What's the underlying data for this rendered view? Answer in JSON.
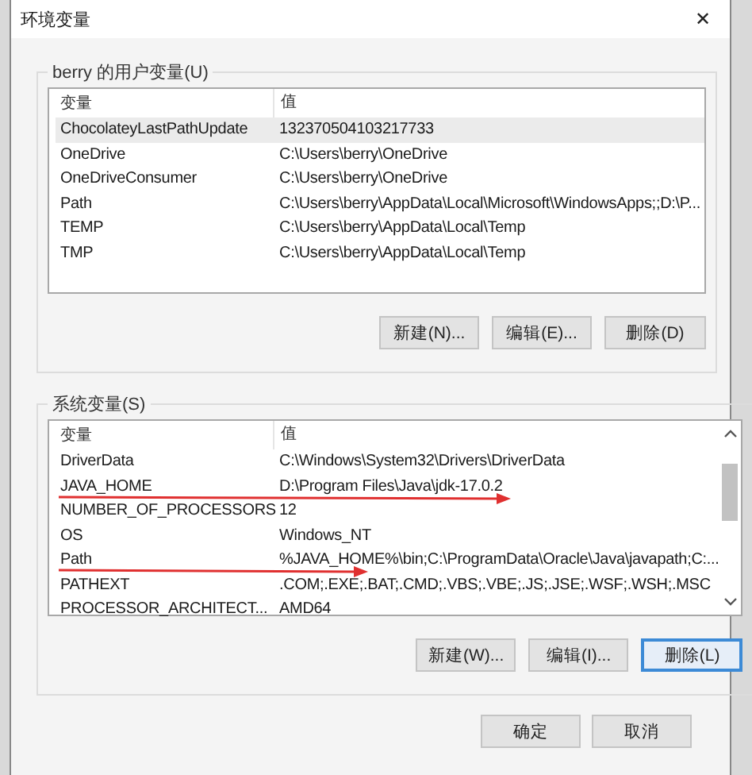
{
  "window": {
    "title": "环境变量",
    "close": "✕"
  },
  "user_group": {
    "title": "berry 的用户变量(U)",
    "columns": [
      "变量",
      "值"
    ],
    "rows": [
      {
        "name": "ChocolateyLastPathUpdate",
        "value": "132370504103217733",
        "selected": true
      },
      {
        "name": "OneDrive",
        "value": "C:\\Users\\berry\\OneDrive",
        "selected": false
      },
      {
        "name": "OneDriveConsumer",
        "value": "C:\\Users\\berry\\OneDrive",
        "selected": false
      },
      {
        "name": "Path",
        "value": "C:\\Users\\berry\\AppData\\Local\\Microsoft\\WindowsApps;;D:\\P...",
        "selected": false
      },
      {
        "name": "TEMP",
        "value": "C:\\Users\\berry\\AppData\\Local\\Temp",
        "selected": false
      },
      {
        "name": "TMP",
        "value": "C:\\Users\\berry\\AppData\\Local\\Temp",
        "selected": false
      }
    ],
    "buttons": [
      {
        "label": "新建(N)...",
        "focused": false
      },
      {
        "label": "编辑(E)...",
        "focused": false
      },
      {
        "label": "删除(D)",
        "focused": false
      }
    ]
  },
  "system_group": {
    "title": "系统变量(S)",
    "columns": [
      "变量",
      "值"
    ],
    "rows": [
      {
        "name": "DriverData",
        "value": "C:\\Windows\\System32\\Drivers\\DriverData",
        "selected": false,
        "underlined": false
      },
      {
        "name": "JAVA_HOME",
        "value": "D:\\Program Files\\Java\\jdk-17.0.2",
        "selected": false,
        "underlined": true
      },
      {
        "name": "NUMBER_OF_PROCESSORS",
        "value": "12",
        "selected": false,
        "underlined": false
      },
      {
        "name": "OS",
        "value": "Windows_NT",
        "selected": false,
        "underlined": false
      },
      {
        "name": "Path",
        "value": "%JAVA_HOME%\\bin;C:\\ProgramData\\Oracle\\Java\\javapath;C:...",
        "selected": false,
        "underlined": true
      },
      {
        "name": "PATHEXT",
        "value": ".COM;.EXE;.BAT;.CMD;.VBS;.VBE;.JS;.JSE;.WSF;.WSH;.MSC",
        "selected": false,
        "underlined": false
      },
      {
        "name": "PROCESSOR_ARCHITECT...",
        "value": "AMD64",
        "selected": false,
        "underlined": false
      }
    ],
    "buttons": [
      {
        "label": "新建(W)...",
        "focused": false
      },
      {
        "label": "编辑(I)...",
        "focused": false
      },
      {
        "label": "删除(L)",
        "focused": true
      }
    ]
  },
  "footer_buttons": [
    {
      "label": "确定",
      "focused": false
    },
    {
      "label": "取消",
      "focused": false
    }
  ]
}
